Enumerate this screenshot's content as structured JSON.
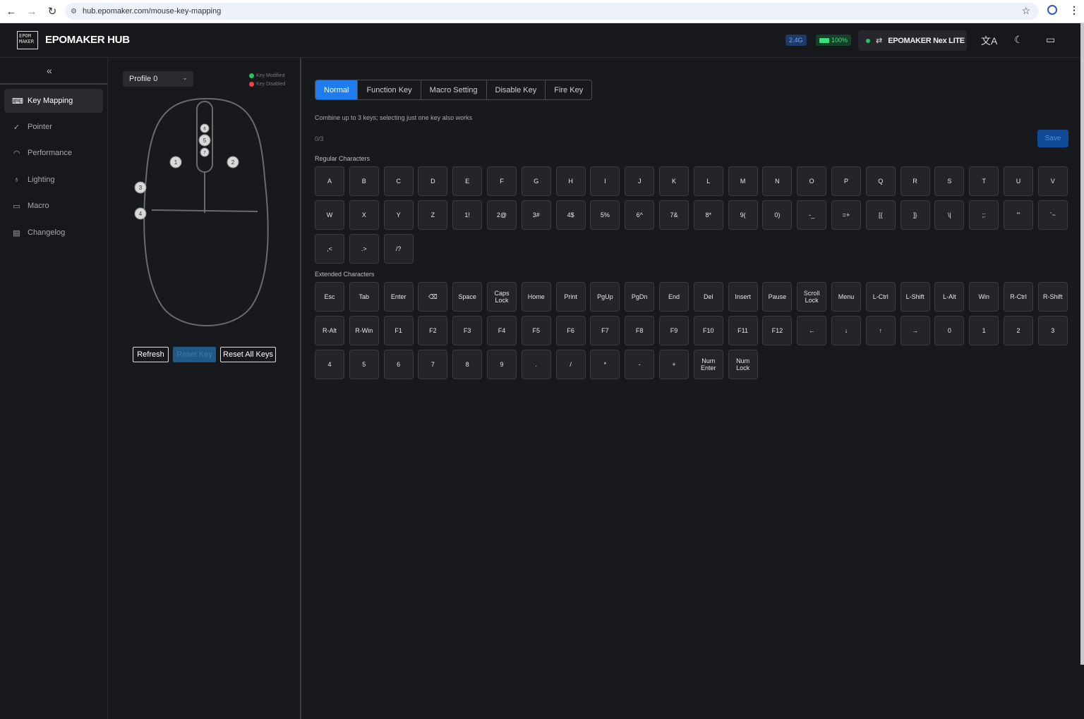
{
  "browser": {
    "url": "hub.epomaker.com/mouse-key-mapping"
  },
  "header": {
    "logo_text": "EPOM MAKER",
    "title": "EPOMAKER HUB",
    "connection_badge": "2.4G",
    "battery_badge": "100%",
    "device_name": "EPOMAKER Nex LITE",
    "status_color": "#22c55e"
  },
  "sidebar": {
    "items": [
      {
        "label": "Key Mapping",
        "icon": "keyboard-icon"
      },
      {
        "label": "Pointer",
        "icon": "pointer-icon"
      },
      {
        "label": "Performance",
        "icon": "gauge-icon"
      },
      {
        "label": "Lighting",
        "icon": "bulb-icon"
      },
      {
        "label": "Macro",
        "icon": "macro-icon"
      },
      {
        "label": "Changelog",
        "icon": "document-icon"
      }
    ]
  },
  "mouse_panel": {
    "profile": "Profile 0",
    "legend": {
      "modified": "Key Modified",
      "disabled": "Key Disabled",
      "modified_color": "#22c55e",
      "disabled_color": "#ef4444"
    },
    "buttons": {
      "refresh": "Refresh",
      "reset_key": "Reset Key",
      "reset_all": "Reset All Keys"
    },
    "markers": [
      "1",
      "2",
      "3",
      "4",
      "5",
      "6",
      "7"
    ]
  },
  "main": {
    "tabs": [
      "Normal",
      "Function Key",
      "Macro Setting",
      "Disable Key",
      "Fire Key"
    ],
    "active_tab": "Normal",
    "hint": "Combine up to 3 keys; selecting just one key also works",
    "counter": "0/3",
    "save_label": "Save",
    "regular_label": "Regular Characters",
    "extended_label": "Extended Characters",
    "regular_keys": [
      "A",
      "B",
      "C",
      "D",
      "E",
      "F",
      "G",
      "H",
      "I",
      "J",
      "K",
      "L",
      "M",
      "N",
      "O",
      "P",
      "Q",
      "R",
      "S",
      "T",
      "U",
      "V",
      "W",
      "X",
      "Y",
      "Z",
      "1!",
      "2@",
      "3#",
      "4$",
      "5%",
      "6^",
      "7&",
      "8*",
      "9(",
      "0)",
      "-_",
      "=+",
      "[{",
      "]}",
      "\\|",
      ";:",
      "'\"",
      "`~",
      ",<",
      ".>",
      "/?"
    ],
    "extended_keys": [
      "Esc",
      "Tab",
      "Enter",
      "⌫",
      "Space",
      "Caps\nLock",
      "Home",
      "Print",
      "PgUp",
      "PgDn",
      "End",
      "Del",
      "Insert",
      "Pause",
      "Scroll\nLock",
      "Menu",
      "L-Ctrl",
      "L-Shift",
      "L-Alt",
      "Win",
      "R-Ctrl",
      "R-Shift",
      "R-Alt",
      "R-Win",
      "F1",
      "F2",
      "F3",
      "F4",
      "F5",
      "F6",
      "F7",
      "F8",
      "F9",
      "F10",
      "F11",
      "F12",
      "←",
      "↓",
      "↑",
      "→",
      "0",
      "1",
      "2",
      "3",
      "4",
      "5",
      "6",
      "7",
      "8",
      "9",
      ".",
      "/",
      "*",
      "-",
      "+",
      "Num\nEnter",
      "Num\nLock"
    ]
  }
}
